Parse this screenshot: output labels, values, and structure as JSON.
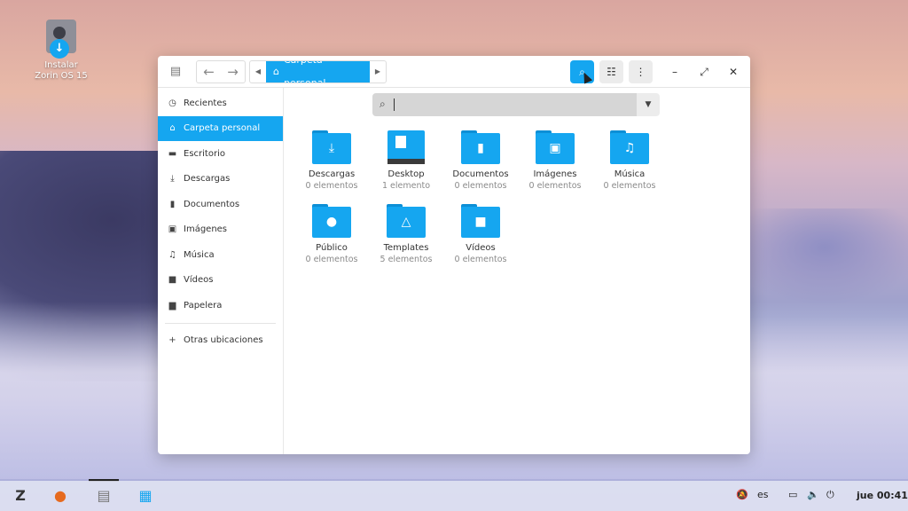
{
  "desktop": {
    "icon_label": "Instalar Zorin OS 15"
  },
  "window": {
    "path": {
      "current": "Carpeta personal"
    },
    "sidebar": {
      "items": [
        {
          "label": "Recientes",
          "icon": "clock-icon"
        },
        {
          "label": "Carpeta personal",
          "icon": "home-icon",
          "selected": true
        },
        {
          "label": "Escritorio",
          "icon": "desktop-icon"
        },
        {
          "label": "Descargas",
          "icon": "download-icon"
        },
        {
          "label": "Documentos",
          "icon": "document-icon"
        },
        {
          "label": "Imágenes",
          "icon": "image-icon"
        },
        {
          "label": "Música",
          "icon": "music-icon"
        },
        {
          "label": "Vídeos",
          "icon": "video-icon"
        },
        {
          "label": "Papelera",
          "icon": "trash-icon"
        }
      ],
      "other_locations": "Otras ubicaciones"
    },
    "search": {
      "value": ""
    },
    "files": [
      {
        "name": "Descargas",
        "count": "0 elementos",
        "icon": "download-icon"
      },
      {
        "name": "Desktop",
        "count": "1 elemento",
        "icon": "desktop-icon"
      },
      {
        "name": "Documentos",
        "count": "0 elementos",
        "icon": "document-icon"
      },
      {
        "name": "Imágenes",
        "count": "0 elementos",
        "icon": "image-icon"
      },
      {
        "name": "Música",
        "count": "0 elementos",
        "icon": "music-icon"
      },
      {
        "name": "Público",
        "count": "0 elementos",
        "icon": "person-icon"
      },
      {
        "name": "Templates",
        "count": "5 elementos",
        "icon": "template-icon"
      },
      {
        "name": "Vídeos",
        "count": "0 elementos",
        "icon": "video-icon"
      }
    ]
  },
  "taskbar": {
    "keyboard_layout": "es",
    "clock": "jue 00:41"
  },
  "colors": {
    "accent": "#15a6f0"
  }
}
